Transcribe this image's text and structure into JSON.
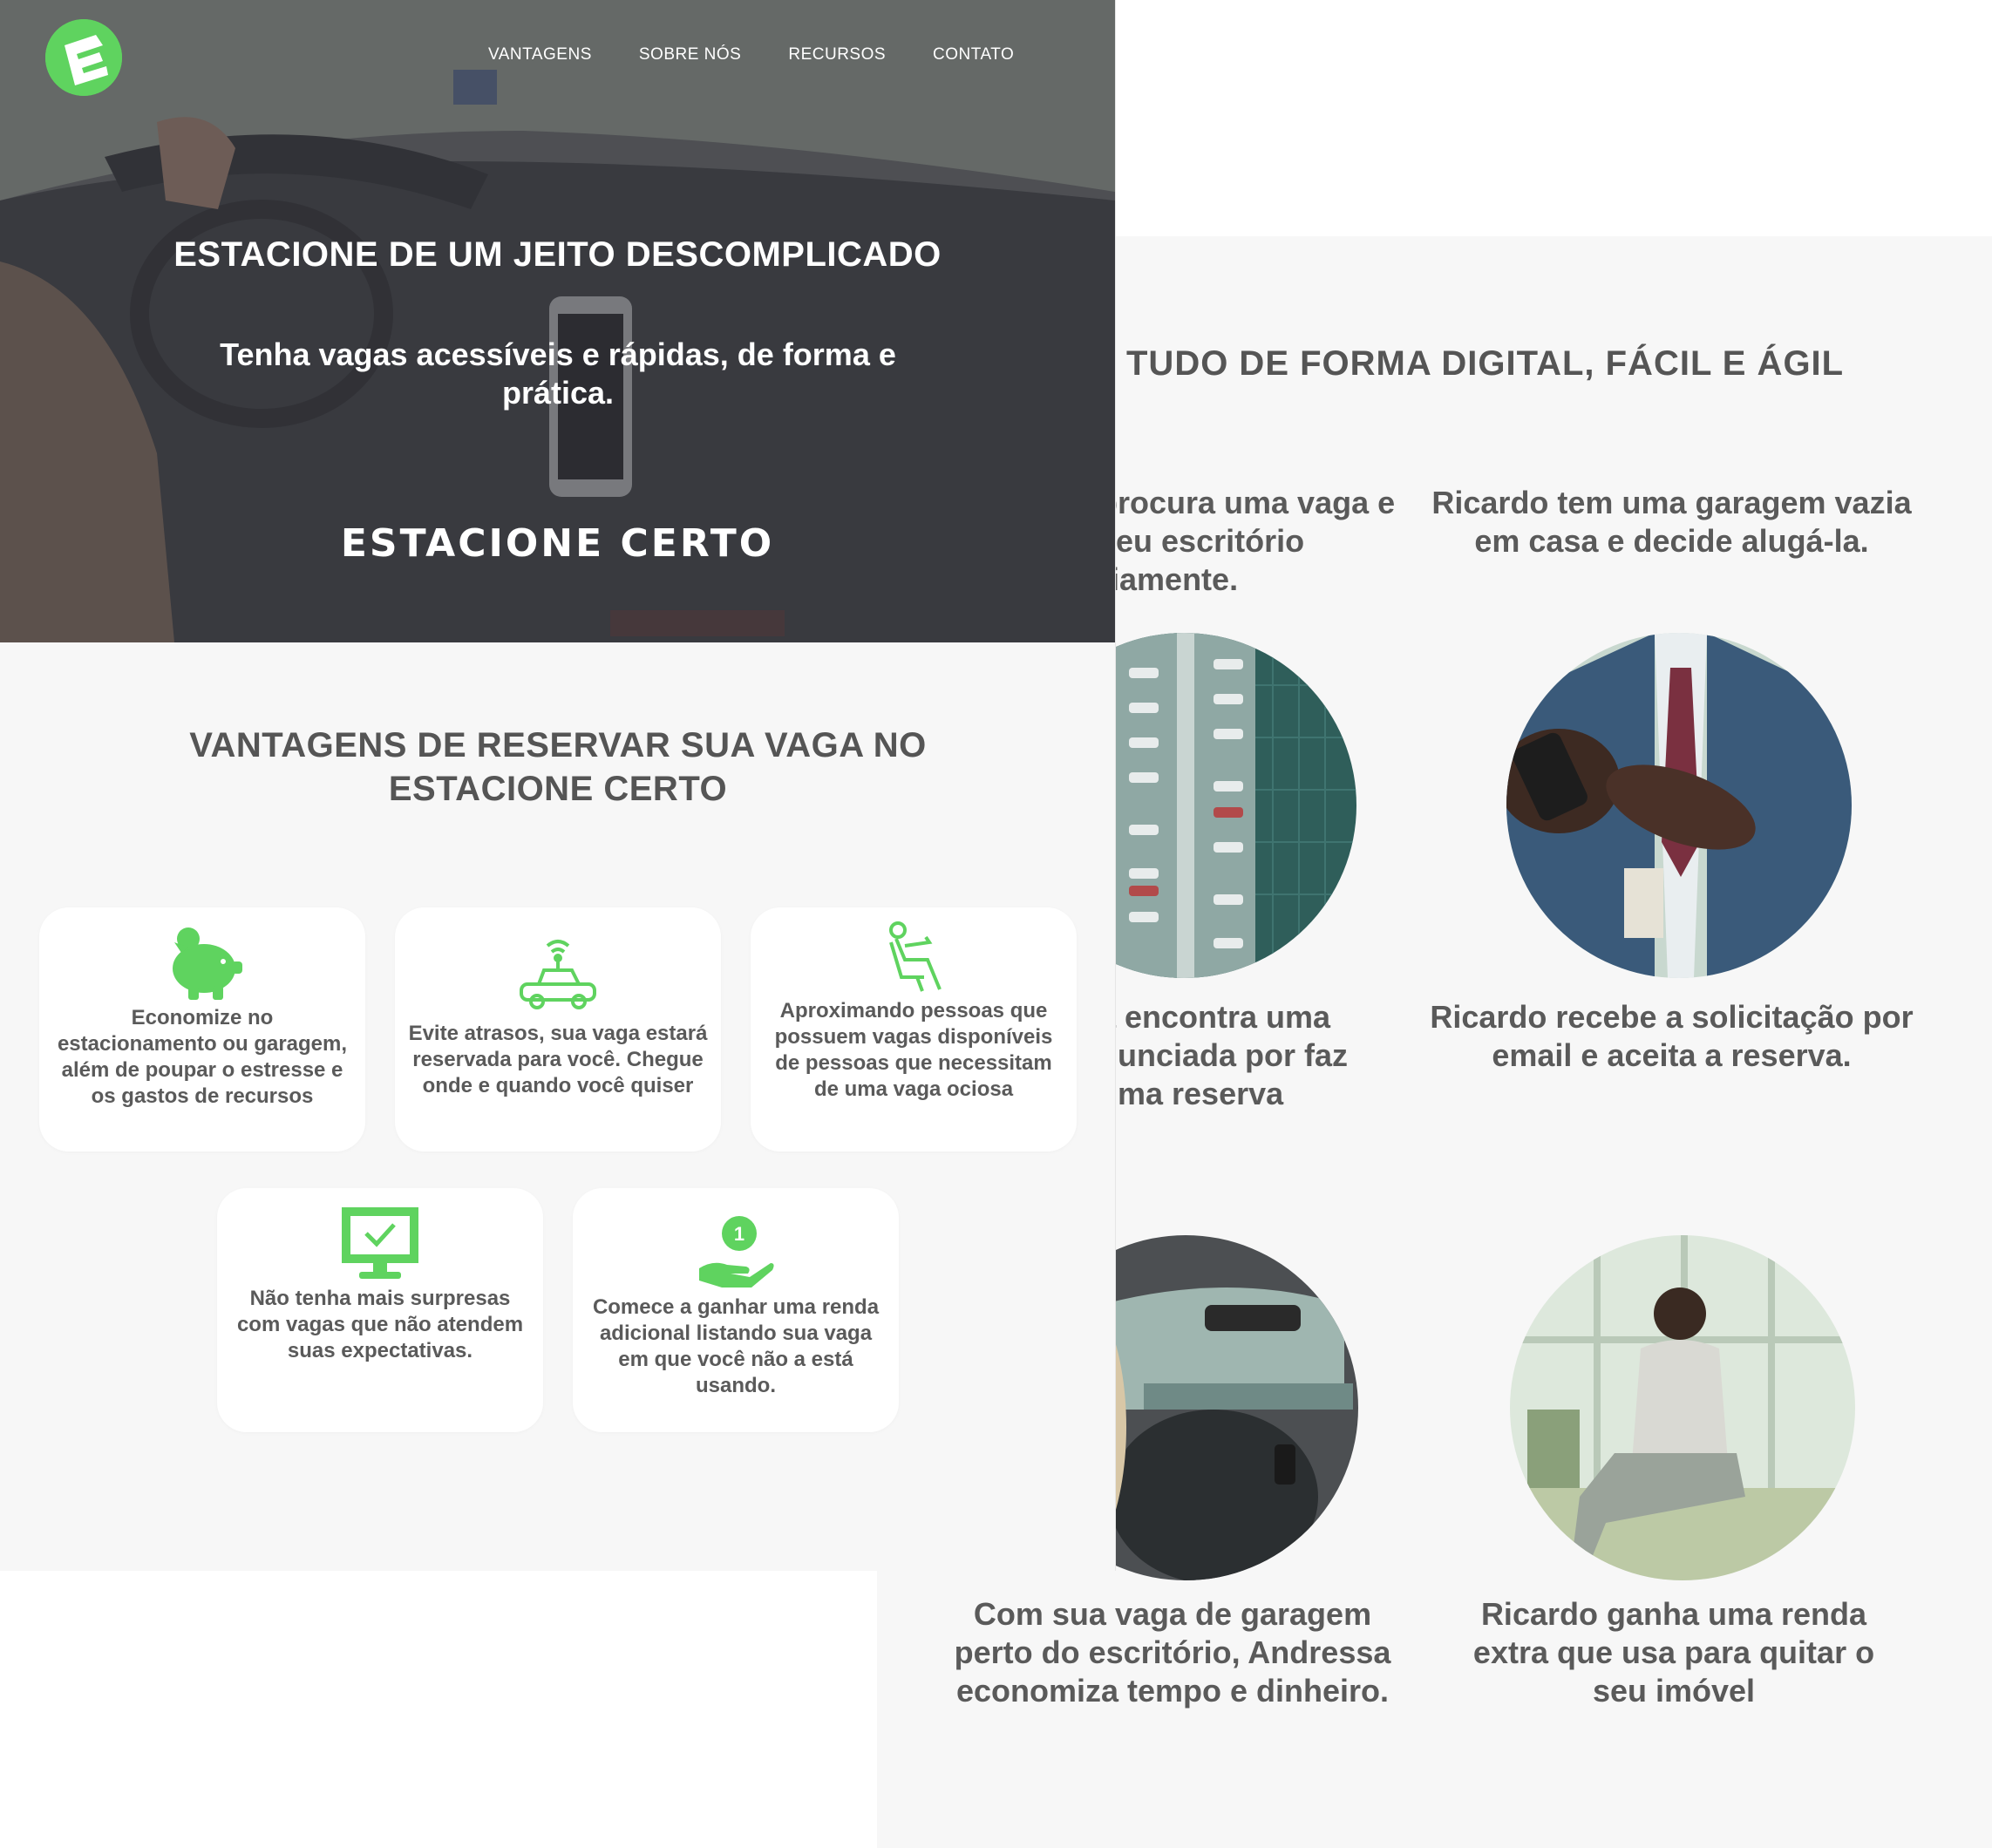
{
  "nav": {
    "logo_alt": "logo",
    "items": [
      "VANTAGENS",
      "SOBRE NÓS",
      "RECURSOS",
      "CONTATO"
    ]
  },
  "hero": {
    "title": "ESTACIONE DE UM JEITO DESCOMPLICADO",
    "subtitle": "Tenha vagas acessíveis e rápidas, de forma e prática.",
    "brand": "ESTACIONE CERTO"
  },
  "advantages": {
    "title": "VANTAGENS DE RESERVAR SUA VAGA NO ESTACIONE CERTO",
    "cards": [
      {
        "icon": "piggy-bank-icon",
        "text": "Economize no estacionamento ou garagem, além de poupar o estresse e os gastos de recursos"
      },
      {
        "icon": "connected-car-icon",
        "text": "Evite atrasos, sua vaga estará reservada para você. Chegue onde e quando você quiser"
      },
      {
        "icon": "person-in-seat-icon",
        "text": "Aproximando pessoas que possuem vagas disponíveis de pessoas que necessitam de uma vaga ociosa"
      },
      {
        "icon": "monitor-check-icon",
        "text": "Não tenha mais surpresas com vagas que não atendem suas expectativas."
      },
      {
        "icon": "hand-coin-icon",
        "text": "Comece a ganhar uma renda adicional listando sua vaga em que você não a está usando."
      }
    ]
  },
  "digital": {
    "title": "TUDO DE FORMA DIGITAL, FÁCIL E ÁGIL",
    "stories": {
      "a1": "procura uma vaga e seu escritório riamente.",
      "b1": "Ricardo tem uma garagem vazia em casa e decide alugá-la.",
      "a2": "a encontra uma nunciada por faz uma reserva",
      "b2": "Ricardo recebe a solicitação por email e aceita a reserva.",
      "a3": "Com sua vaga de garagem perto do escritório, Andressa economiza tempo e dinheiro.",
      "b3": "Ricardo ganha uma renda extra que usa para quitar o seu imóvel"
    }
  },
  "colors": {
    "accent": "#5fd35f",
    "text": "#555555",
    "background": "#f7f7f7"
  }
}
